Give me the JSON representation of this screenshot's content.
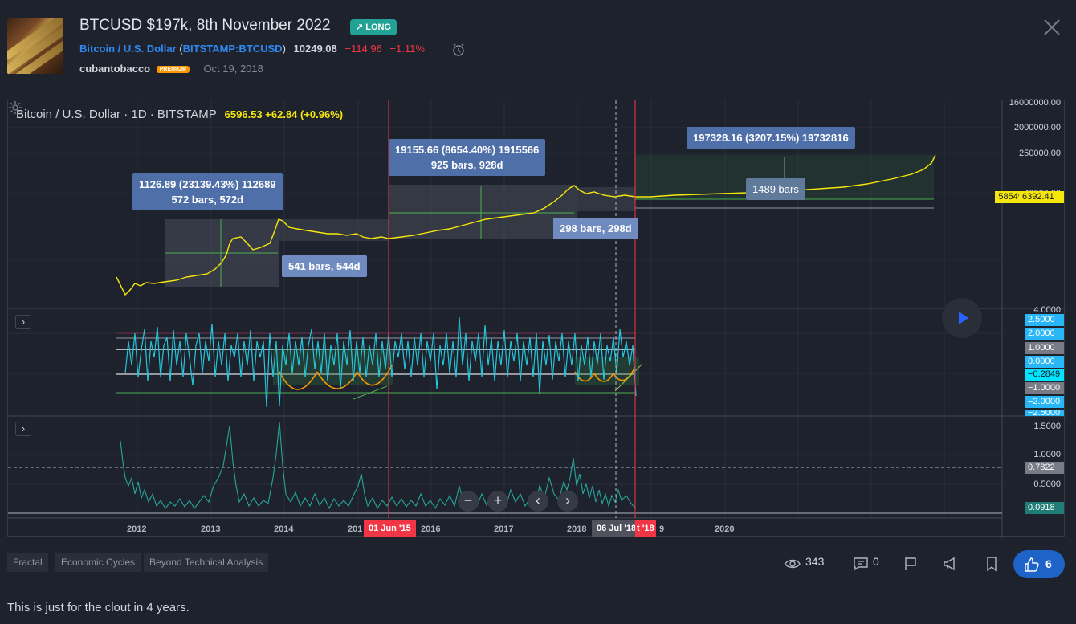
{
  "idea": {
    "title": "BTCUSD $197k, 8th November 2022",
    "direction": "LONG",
    "symbol_name": "Bitcoin / U.S. Dollar",
    "symbol_code": "BITSTAMP:BTCUSD",
    "price": "10249.08",
    "change": "−114.96",
    "change_pct": "−1.11%",
    "author": "cubantobacco",
    "author_badge": "PREMIUM",
    "date": "Oct 19, 2018"
  },
  "chart": {
    "legend_symbol": "Bitcoin / U.S. Dollar · 1D · BITSTAMP",
    "legend_values": "6596.53 +62.84 (+0.96%)",
    "annotations": {
      "box1_line1": "1126.89 (23139.43%) 112689",
      "box1_line2": "572 bars, 572d",
      "box2": "541 bars, 544d",
      "box3_line1": "19155.66 (8654.40%) 1915566",
      "box3_line2": "925 bars, 928d",
      "box4": "298 bars, 298d",
      "box5": "197328.16 (3207.15%) 19732816",
      "box6": "1489 bars"
    },
    "price_axis": [
      "16000000.00",
      "2000000.00",
      "250000.00",
      "40000.00"
    ],
    "price_badge_pct": "58545.96%",
    "price_badge_val": "6392.41",
    "osc_axis": [
      "4.0000",
      "2.5000",
      "2.0000",
      "1.0000",
      "0.0000",
      "−0.2849",
      "−1.0000",
      "−2.0000",
      "−2.5000"
    ],
    "vol_axis": [
      "1.5000",
      "1.0000",
      "0.7822",
      "0.5000",
      "0.0918"
    ],
    "x_ticks": [
      "2012",
      "2013",
      "2014",
      "201",
      "2016",
      "2017",
      "2018",
      "9",
      "2020"
    ],
    "x_badge_1": "01 Jun '15",
    "x_badge_2": "06 Jul '18",
    "x_badge_3": "t '18",
    "colors": {
      "price": "#f5e70b",
      "oscillator": "#26c6da",
      "volatility": "#26a69a",
      "vline": "#f23645",
      "fill": "#2f6e3f"
    }
  },
  "tags": [
    "Fractal",
    "Economic Cycles",
    "Beyond Technical Analysis"
  ],
  "stats": {
    "views": "343",
    "comments": "0",
    "likes": "6"
  },
  "description": "This is just for the clout in 4 years."
}
